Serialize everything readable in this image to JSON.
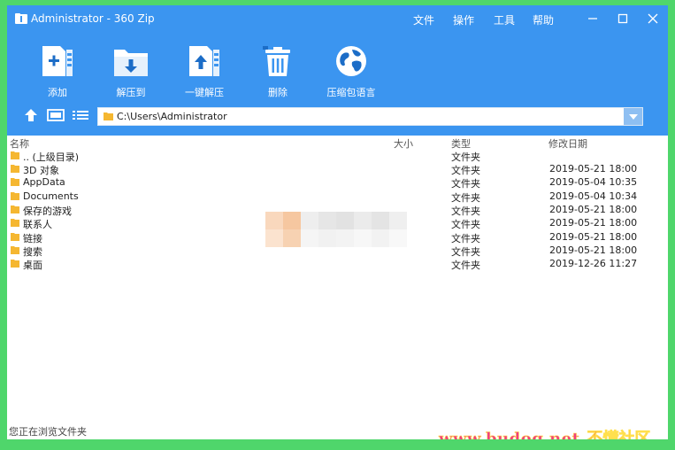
{
  "window": {
    "title": "Administrator - 360 Zip",
    "menu": [
      "文件",
      "操作",
      "工具",
      "帮助"
    ]
  },
  "toolbar": {
    "items": [
      {
        "label": "添加",
        "icon": "add-archive-icon"
      },
      {
        "label": "解压到",
        "icon": "extract-to-icon"
      },
      {
        "label": "一键解压",
        "icon": "one-click-extract-icon"
      },
      {
        "label": "删除",
        "icon": "delete-icon"
      },
      {
        "label": "压缩包语言",
        "icon": "globe-icon"
      }
    ]
  },
  "address": {
    "path": "C:\\Users\\Administrator"
  },
  "columns": {
    "name": "名称",
    "size": "大小",
    "type": "类型",
    "modified": "修改日期"
  },
  "files": [
    {
      "name": ".. (上级目录)",
      "type": "文件夹",
      "modified": ""
    },
    {
      "name": "3D 对象",
      "type": "文件夹",
      "modified": "2019-05-21 18:00"
    },
    {
      "name": "AppData",
      "type": "文件夹",
      "modified": "2019-05-04 10:35"
    },
    {
      "name": "Documents",
      "type": "文件夹",
      "modified": "2019-05-04 10:34"
    },
    {
      "name": "保存的游戏",
      "type": "文件夹",
      "modified": "2019-05-21 18:00"
    },
    {
      "name": "联系人",
      "type": "文件夹",
      "modified": "2019-05-21 18:00"
    },
    {
      "name": "链接",
      "type": "文件夹",
      "modified": "2019-05-21 18:00"
    },
    {
      "name": "搜索",
      "type": "文件夹",
      "modified": "2019-05-21 18:00"
    },
    {
      "name": "桌面",
      "type": "文件夹",
      "modified": "2019-12-26 11:27"
    }
  ],
  "status": {
    "text": "您正在浏览文件夹"
  },
  "watermark": {
    "url": "www.budog.net",
    "site": "不懂社区"
  },
  "colors": {
    "header": "#3b95f0",
    "background": "#4fd66b",
    "folder": "#f5b731"
  }
}
